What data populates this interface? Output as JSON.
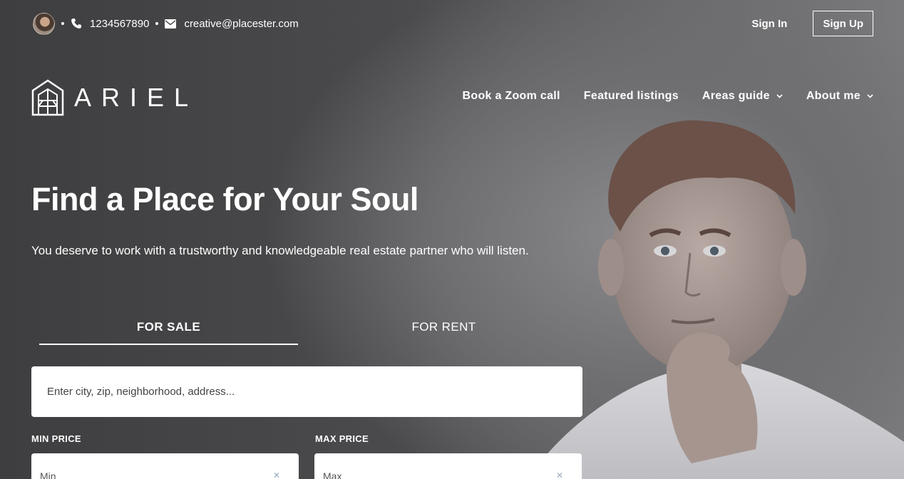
{
  "topbar": {
    "phone": "1234567890",
    "email": "creative@placester.com",
    "sign_in": "Sign In",
    "sign_up": "Sign Up"
  },
  "brand": {
    "logo_text": "ARIEL"
  },
  "nav": {
    "items": [
      {
        "label": "Book a Zoom call",
        "has_dropdown": false
      },
      {
        "label": "Featured listings",
        "has_dropdown": false
      },
      {
        "label": "Areas guide",
        "has_dropdown": true
      },
      {
        "label": "About me",
        "has_dropdown": true
      }
    ]
  },
  "hero": {
    "title": "Find a Place for Your Soul",
    "subtitle": "You deserve to work with a trustworthy and knowledgeable real estate partner who will listen."
  },
  "search": {
    "tabs": [
      "FOR SALE",
      "FOR RENT"
    ],
    "active_tab": "FOR SALE",
    "placeholder": "Enter city, zip, neighborhood, address...",
    "min_price_label": "MIN PRICE",
    "max_price_label": "MAX PRICE",
    "min_value": "Min",
    "max_value": "Max"
  },
  "colors": {
    "text": "#ffffff",
    "input_bg": "#ffffff"
  },
  "icons": [
    "avatar",
    "phone-icon",
    "mail-icon",
    "logo-house-icon",
    "chevron-down-icon"
  ]
}
